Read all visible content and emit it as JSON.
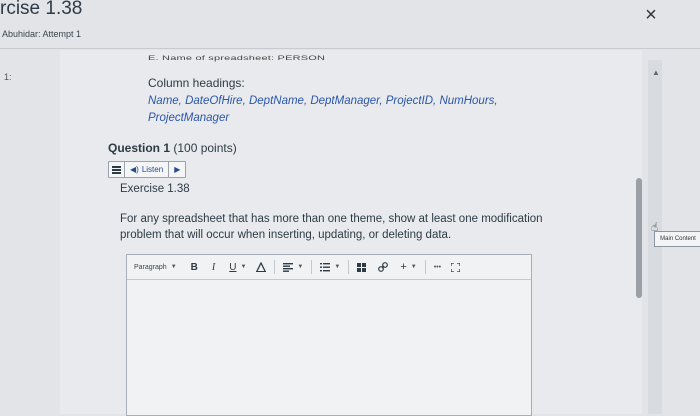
{
  "header": {
    "title": "rcise 1.38",
    "subtitle": "Abuhidar: Attempt 1",
    "close_label": "×"
  },
  "question_number": "1:",
  "content": {
    "cut_off_line": "E. Name of spreadsheet: PERSON",
    "column_headings_label": "Column headings:",
    "column_headings_list": "Name, DateOfHire, DeptName, DeptManager, ProjectID, NumHours, ProjectManager"
  },
  "question": {
    "title": "Question 1",
    "points": "(100 points)",
    "listen_label": "Listen",
    "exercise_label": "Exercise 1.38",
    "prompt": "For any spreadsheet that has more than one theme, show at least one modification problem that will occur when inserting, updating, or deleting data."
  },
  "editor": {
    "paragraph_label": "Paragraph",
    "bold": "B",
    "italic": "I",
    "underline": "U",
    "plus": "+",
    "more": "•••"
  },
  "sidebar": {
    "main_content_label": "Main Content"
  },
  "colors": {
    "link_blue": "#2b56a8",
    "text": "#2d3b45"
  }
}
